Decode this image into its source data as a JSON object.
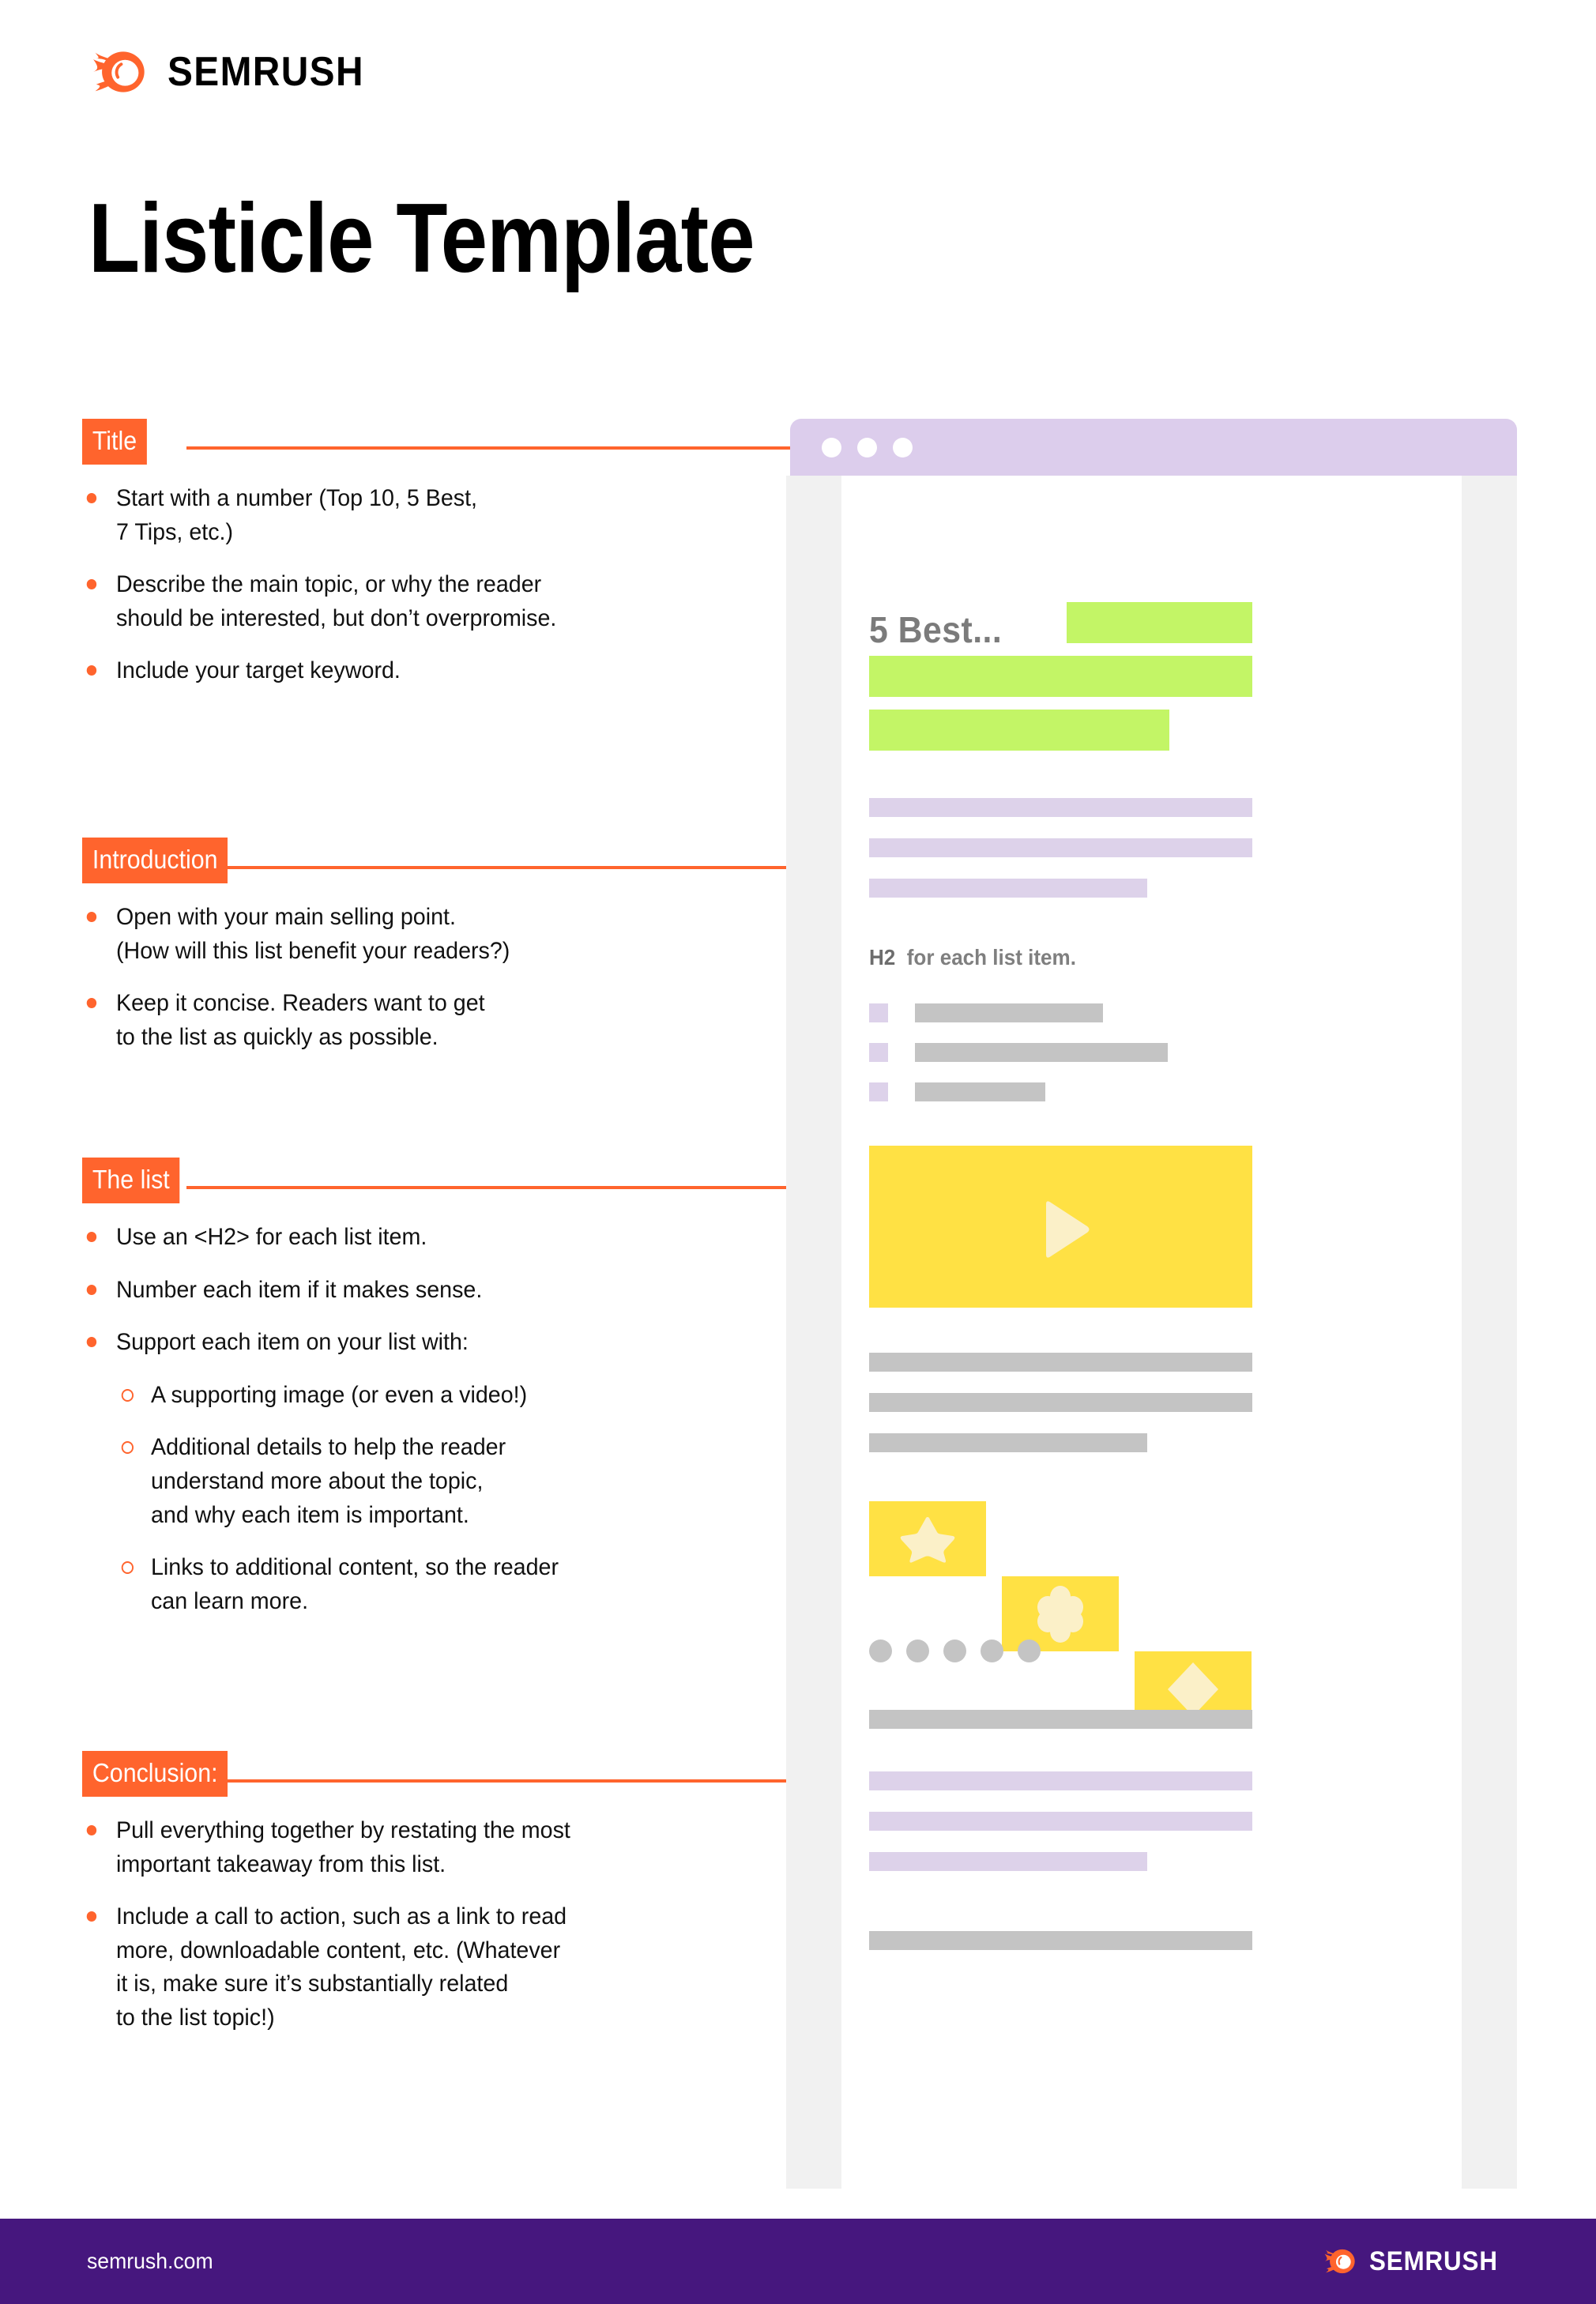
{
  "brand": {
    "name": "SEMRUSH",
    "logo_icon": "semrush-flame-logo",
    "accent_orange": "#ff642d",
    "footer_purple": "#46177e"
  },
  "header": {
    "title": "Listicle Template"
  },
  "sections": [
    {
      "tag": "Title",
      "bullets": [
        "Start with a number (Top 10, 5 Best,\n7 Tips, etc.)",
        "Describe the main topic, or why the reader\nshould be interested, but don’t overpromise.",
        "Include your target keyword."
      ],
      "sub_bullets": []
    },
    {
      "tag": "Introduction",
      "bullets": [
        "Open with your main selling point.\n(How will this list benefit your readers?)",
        "Keep it concise. Readers want to get\nto the list as quickly as possible."
      ],
      "sub_bullets": []
    },
    {
      "tag": "The list",
      "bullets": [
        "Use an <H2> for each list item.",
        "Number each item if it makes sense.",
        "Support each item on your list with:"
      ],
      "sub_bullets": [
        "A supporting image (or even a video!)",
        "Additional details to help the reader\nunderstand more about the topic,\nand why each item is important.",
        "Links to additional content, so the reader\ncan learn more."
      ]
    },
    {
      "tag": "Conclusion:",
      "bullets": [
        "Pull everything together by restating the most\nimportant takeaway from this list.",
        "Include a call to action, such as a link to read\nmore, downloadable content, etc. (Whatever\nit is, make sure it’s substantially related\nto the list topic!)"
      ],
      "sub_bullets": []
    }
  ],
  "mockup": {
    "chrome": {
      "dots": 3,
      "bar_color": "#dccdec"
    },
    "page_title": "5 Best...",
    "h2_label": "H2",
    "h2_text": "for each list item.",
    "placeholder_colors": {
      "green": "#c3f566",
      "lilac": "#ddd2ea",
      "gray": "#c4c4c4",
      "yellow": "#ffe144",
      "shape_fill": "#fbf0c8"
    },
    "video_icon": "play-triangle-icon",
    "shape_cards": [
      "star-icon",
      "flower-icon",
      "diamond-icon"
    ],
    "avatar_dots": 5
  },
  "footer": {
    "link": "semrush.com",
    "brand": "SEMRUSH"
  }
}
